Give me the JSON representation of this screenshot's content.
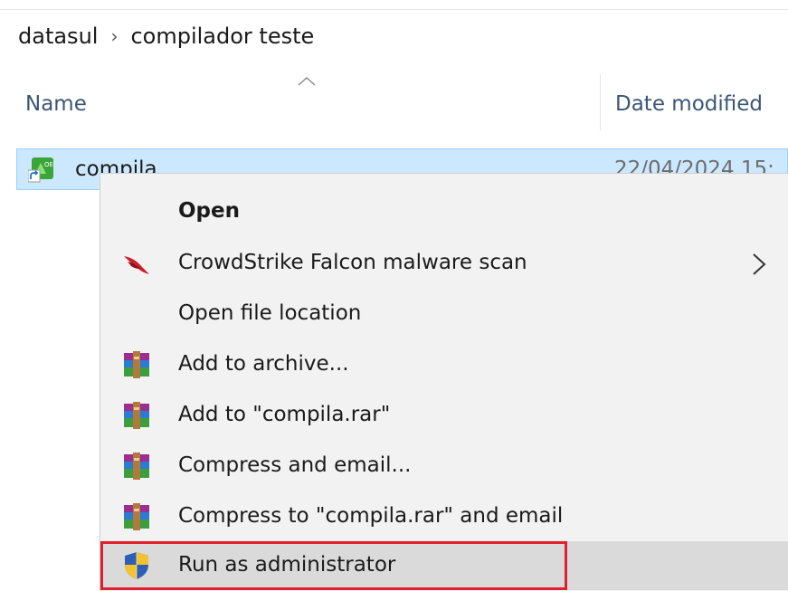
{
  "breadcrumb": {
    "parts": [
      "datasul",
      "compilador teste"
    ]
  },
  "columns": {
    "name": "Name",
    "date_modified": "Date modified"
  },
  "file": {
    "name": "compila",
    "date": "22/04/2024 15:"
  },
  "context_menu": {
    "items": [
      {
        "label": "Open",
        "bold": true,
        "icon": ""
      },
      {
        "label": "CrowdStrike Falcon malware scan",
        "icon": "crowdstrike-falcon-icon",
        "submenu": true
      },
      {
        "label": "Open file location",
        "icon": ""
      },
      {
        "label": "Add to archive...",
        "icon": "winrar-icon"
      },
      {
        "label": "Add to \"compila.rar\"",
        "icon": "winrar-icon"
      },
      {
        "label": "Compress and email...",
        "icon": "winrar-icon"
      },
      {
        "label": "Compress to \"compila.rar\" and email",
        "icon": "winrar-icon"
      },
      {
        "label": "Run as administrator",
        "icon": "uac-shield-icon",
        "hovered": true,
        "highlighted": true
      }
    ]
  },
  "colors": {
    "selection": "#cce8ff",
    "selection_border": "#99d1ff",
    "menu_bg": "#f2f2f2",
    "hover": "#dadada",
    "highlight_box": "#e0202c"
  }
}
